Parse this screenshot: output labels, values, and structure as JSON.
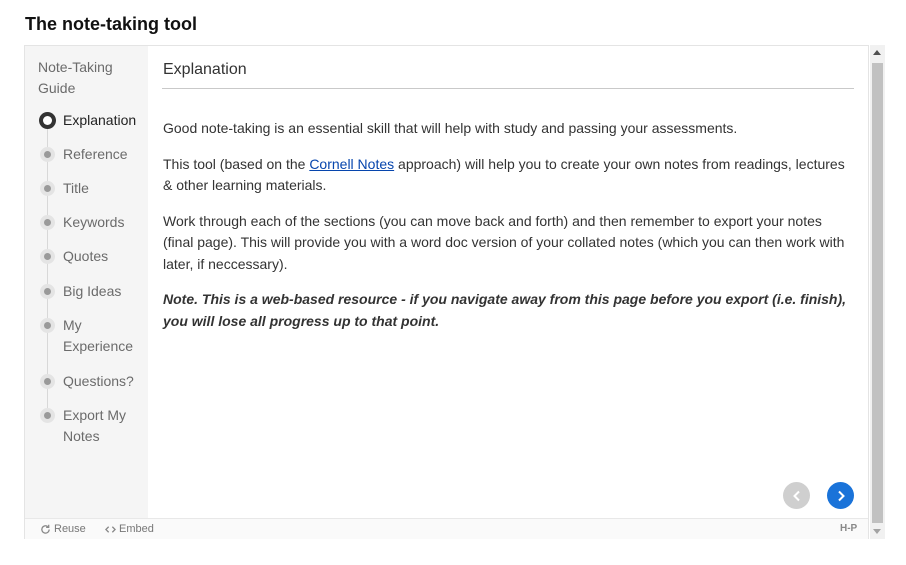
{
  "page_title": "The note-taking tool",
  "sidebar": {
    "heading": "Note-Taking Guide",
    "steps": [
      {
        "label": "Explanation",
        "active": true
      },
      {
        "label": "Reference",
        "active": false
      },
      {
        "label": "Title",
        "active": false
      },
      {
        "label": "Keywords",
        "active": false
      },
      {
        "label": "Quotes",
        "active": false
      },
      {
        "label": "Big Ideas",
        "active": false
      },
      {
        "label": "My Experience",
        "active": false
      },
      {
        "label": "Questions?",
        "active": false
      },
      {
        "label": "Export My Notes",
        "active": false
      }
    ]
  },
  "content": {
    "section_title": "Explanation",
    "paragraph1": "Good note-taking is an essential skill that will help with study and passing your assessments.",
    "paragraph2_before_link": "This tool (based on the ",
    "paragraph2_link": "Cornell Notes",
    "paragraph2_after_link": " approach) will help you to create your own notes from readings, lectures & other learning materials.",
    "paragraph3": "Work through each of the sections (you can move back and forth) and then remember to export your notes (final page). This will provide you with a word doc version of your collated notes (which you can then work with later, if neccessary).",
    "note": "Note. This is a web-based resource - if you navigate away from this page before you export (i.e. finish), you will lose all progress up to that point."
  },
  "footer": {
    "reuse_label": "Reuse",
    "embed_label": "Embed",
    "logo_text": "H-P"
  },
  "icons": {
    "prev": "chevron-left-icon",
    "next": "chevron-right-icon",
    "reuse": "refresh-icon",
    "embed": "code-icon"
  },
  "colors": {
    "next_button": "#1a73d9",
    "prev_button": "#cfcfcf",
    "link": "#0645ad",
    "sidebar_bg": "#f5f5f5"
  }
}
